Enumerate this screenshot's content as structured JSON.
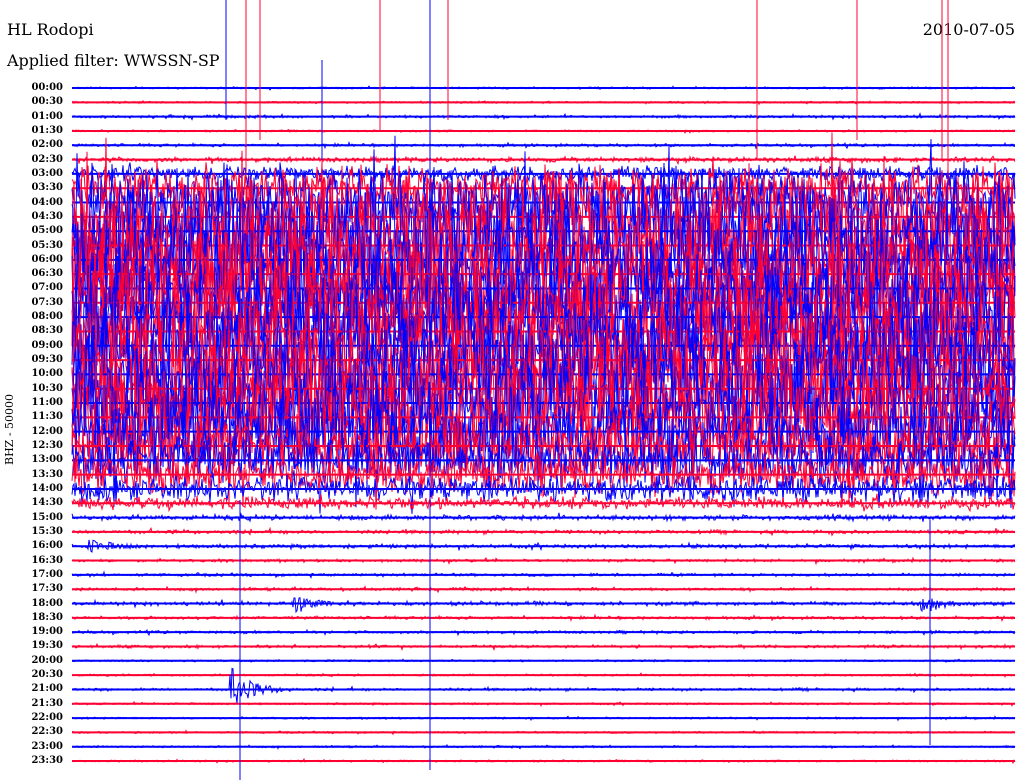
{
  "header": {
    "station": "HL Rodopi",
    "filter": "Applied filter: WWSSN-SP",
    "date": "2010-07-05"
  },
  "channel_label": "BHZ - 50000",
  "colors": {
    "even": "#0000ff",
    "odd": "#ff0033"
  },
  "chart_data": {
    "type": "line",
    "title": "HL Rodopi 2010-07-05",
    "ylabel": "BHZ - 50000",
    "row_labels": [
      "00:00",
      "00:30",
      "01:00",
      "01:30",
      "02:00",
      "02:30",
      "03:00",
      "03:30",
      "04:00",
      "04:30",
      "05:00",
      "05:30",
      "06:00",
      "06:30",
      "07:00",
      "07:30",
      "08:00",
      "08:30",
      "09:00",
      "09:30",
      "10:00",
      "10:30",
      "11:00",
      "11:30",
      "12:00",
      "12:30",
      "13:00",
      "13:30",
      "14:00",
      "14:30",
      "15:00",
      "15:30",
      "16:00",
      "16:30",
      "17:00",
      "17:30",
      "18:00",
      "18:30",
      "19:00",
      "19:30",
      "20:00",
      "20:30",
      "21:00",
      "21:30",
      "22:00",
      "22:30",
      "23:00",
      "23:30"
    ],
    "relative_amplitude": [
      0.02,
      0.02,
      0.03,
      0.02,
      0.03,
      0.05,
      0.15,
      0.4,
      0.7,
      0.9,
      1,
      1,
      1,
      1,
      1,
      1,
      1,
      1,
      1,
      1,
      1,
      1,
      1,
      1,
      0.8,
      0.6,
      0.5,
      0.4,
      0.25,
      0.12,
      0.05,
      0.04,
      0.04,
      0.03,
      0.03,
      0.03,
      0.04,
      0.03,
      0.03,
      0.03,
      0.02,
      0.02,
      0.03,
      0.02,
      0.02,
      0.02,
      0.02,
      0.02
    ],
    "events": [
      {
        "row": "21:00",
        "minute": 5,
        "relative_amplitude": 0.4
      },
      {
        "row": "18:00",
        "minute": 7,
        "relative_amplitude": 0.15
      },
      {
        "row": "18:00",
        "minute": 27,
        "relative_amplitude": 0.12
      },
      {
        "row": "16:00",
        "minute": 0.5,
        "relative_amplitude": 0.12
      }
    ],
    "minutes_per_row": 30
  }
}
